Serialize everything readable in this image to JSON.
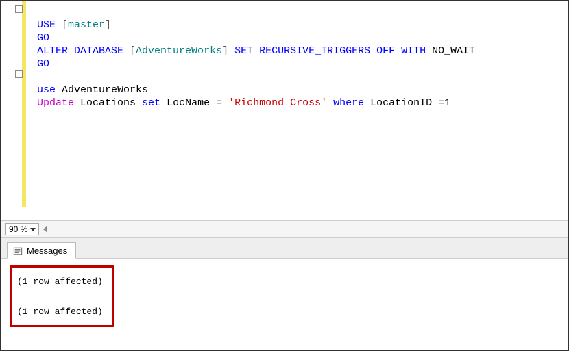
{
  "code": {
    "line1": {
      "use": "USE",
      "open": " [",
      "db": "master",
      "close": "]"
    },
    "line2": {
      "go": "GO"
    },
    "line3": {
      "alter": "ALTER",
      "database": " DATABASE",
      "open": " [",
      "db": "AdventureWorks",
      "close": "]",
      "set": " SET",
      "opt": " RECURSIVE_TRIGGERS",
      "off": " OFF",
      "with": " WITH",
      "nowait": " NO_WAIT"
    },
    "line4": {
      "go": "GO"
    },
    "line6": {
      "use": "use",
      "db": " AdventureWorks"
    },
    "line7": {
      "update": "Update",
      "tbl": " Locations ",
      "set": "set",
      "col": " LocName ",
      "eq": "=",
      "strlit": " 'Richmond Cross' ",
      "where": "where",
      "cond": " LocationID ",
      "eq2": "=",
      "val": "1"
    }
  },
  "zoom": {
    "level": "90 %"
  },
  "tabs": {
    "messages": "Messages"
  },
  "messages": {
    "line1": "(1 row affected)",
    "line2": "(1 row affected)"
  }
}
